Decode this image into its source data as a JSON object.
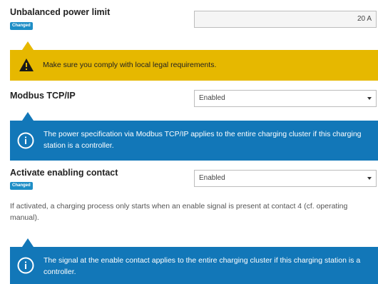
{
  "power_limit": {
    "label": "Unbalanced power limit",
    "badge": "Changed",
    "value": "20 A",
    "warning_text": "Make sure you comply with local legal requirements.",
    "warning_icon": "warning-triangle-icon"
  },
  "modbus": {
    "label": "Modbus TCP/IP",
    "selected": "Enabled",
    "info_text": "The power specification via Modbus TCP/IP applies to the entire charging cluster if this charging station is a controller.",
    "info_icon": "info-circle-icon"
  },
  "enabling_contact": {
    "label": "Activate enabling contact",
    "badge": "Changed",
    "selected": "Enabled",
    "description": "If activated, a charging process only starts when an enable signal is present at contact 4 (cf. operating manual).",
    "info_text": "The signal at the enable contact applies to the entire charging cluster if this charging station is a controller.",
    "info_icon": "info-circle-icon"
  },
  "colors": {
    "badge": "#1e8ec6",
    "warning": "#e6b800",
    "info": "#1277b8"
  }
}
